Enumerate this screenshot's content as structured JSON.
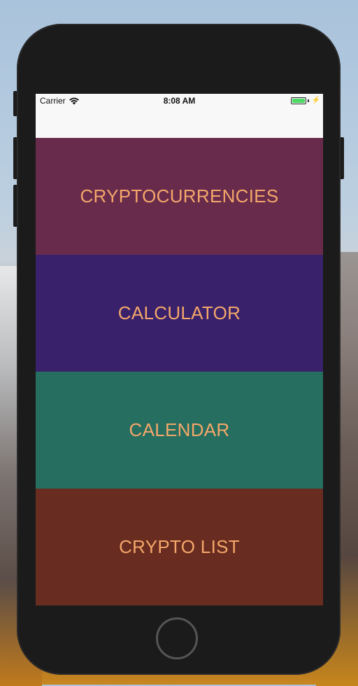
{
  "status_bar": {
    "carrier": "Carrier",
    "time": "8:08 AM",
    "battery_level": 1.0,
    "charging": true
  },
  "menu": {
    "items": [
      {
        "label": "CRYPTOCURRENCIES",
        "color": "#682b4b"
      },
      {
        "label": "CALCULATOR",
        "color": "#39226b"
      },
      {
        "label": "CALENDAR",
        "color": "#266e5f"
      },
      {
        "label": "CRYPTO LIST",
        "color": "#692c20"
      }
    ],
    "text_color": "#f4a76a"
  }
}
